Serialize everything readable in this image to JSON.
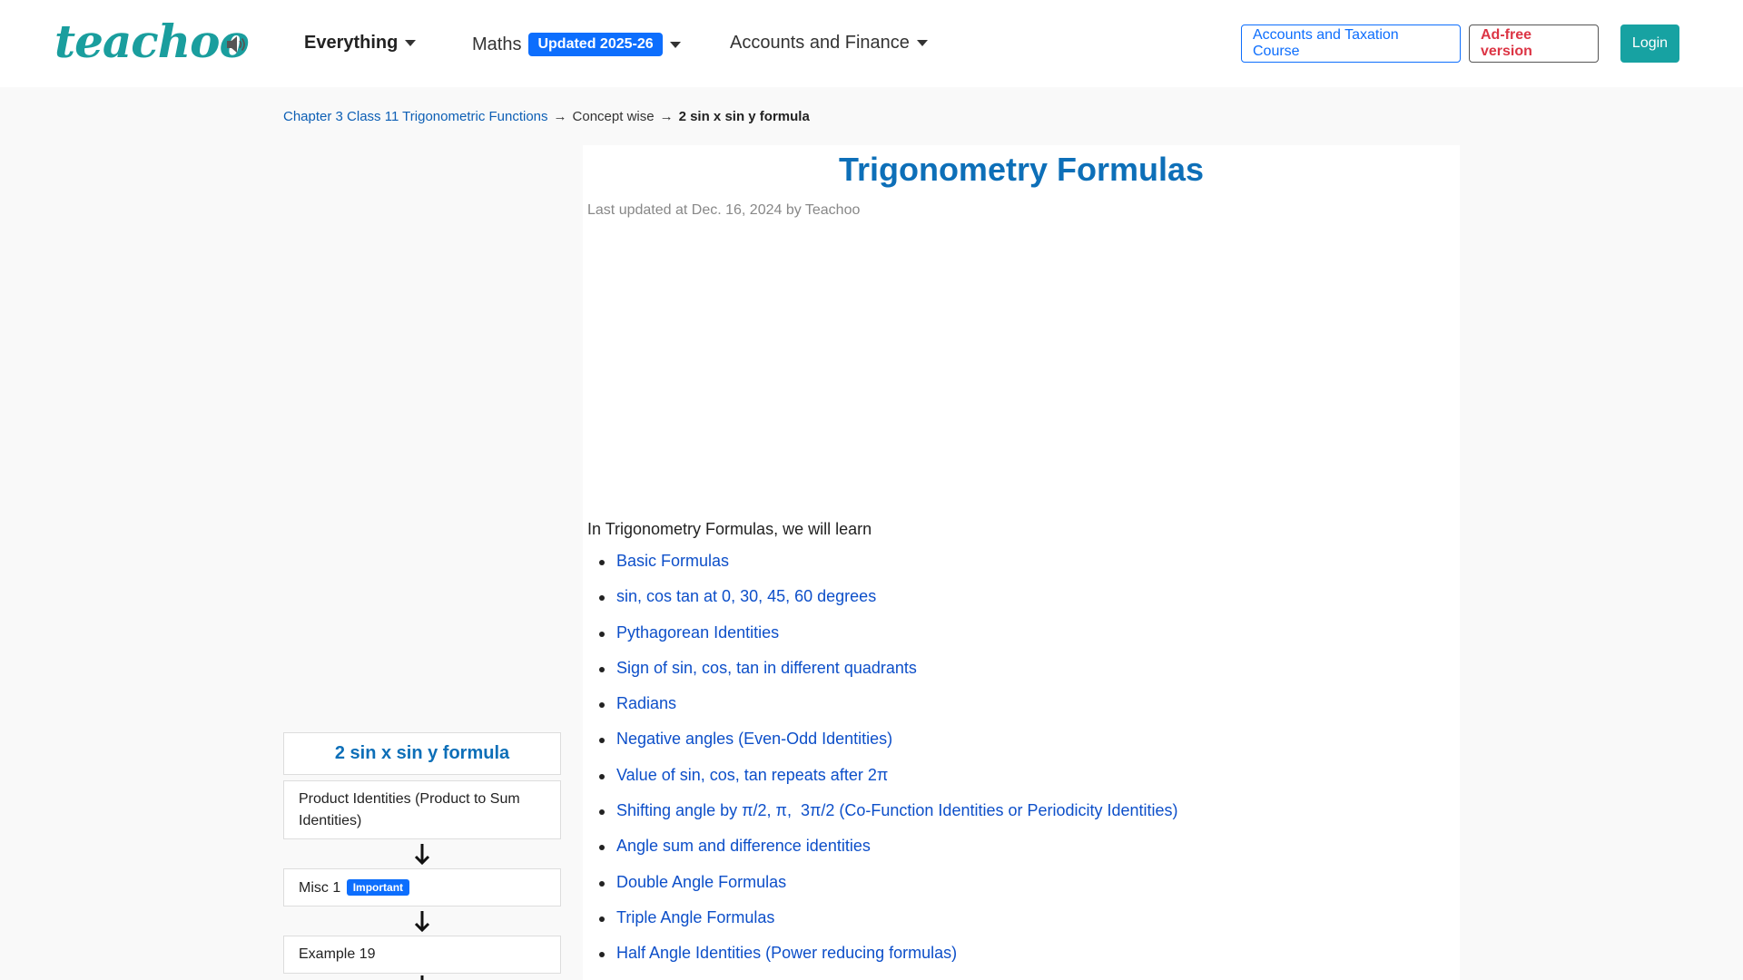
{
  "brand": {
    "logo_text": "teachoo"
  },
  "nav": {
    "everything": "Everything",
    "maths": "Maths",
    "maths_badge": "Updated 2025-26",
    "accounts": "Accounts and Finance"
  },
  "buttons": {
    "course": "Accounts and Taxation Course",
    "adfree": "Ad-free version",
    "login": "Login"
  },
  "breadcrumb": {
    "chapter": "Chapter 3 Class 11 Trigonometric Functions",
    "sep1": "→",
    "concept": "Concept wise",
    "sep2": "→",
    "current": "2 sin x sin y formula"
  },
  "sidebar": {
    "title": "2 sin x sin y formula",
    "items": [
      {
        "label": "Product Identities (Product to Sum Identities)"
      },
      {
        "label": "Misc 1",
        "badge": "Important"
      },
      {
        "label": "Example 19"
      }
    ]
  },
  "main": {
    "title": "Trigonometry Formulas",
    "updated": "Last updated at Dec. 16, 2024 by Teachoo",
    "intro": "In Trigonometry Formulas, we will learn",
    "topics": [
      "Basic Formulas",
      "sin, cos tan at 0, 30, 45, 60 degrees",
      "Pythagorean Identities",
      "Sign of sin, cos, tan in different quadrants",
      "Radians",
      "Negative angles (Even-Odd Identities)",
      "Value of sin, cos, tan repeats after 2π",
      "Shifting angle by π/2, π,  3π/2 (Co-Function Identities or Periodicity Identities)",
      "Angle sum and difference identities",
      "Double Angle Formulas",
      "Triple Angle Formulas",
      "Half Angle Identities (Power reducing formulas)"
    ]
  },
  "colors": {
    "brand_teal": "#1a9e9e",
    "link_blue": "#0d4fc9",
    "title_blue": "#0d6fb8",
    "badge_blue": "#0d6efd",
    "danger": "#dc3545"
  }
}
